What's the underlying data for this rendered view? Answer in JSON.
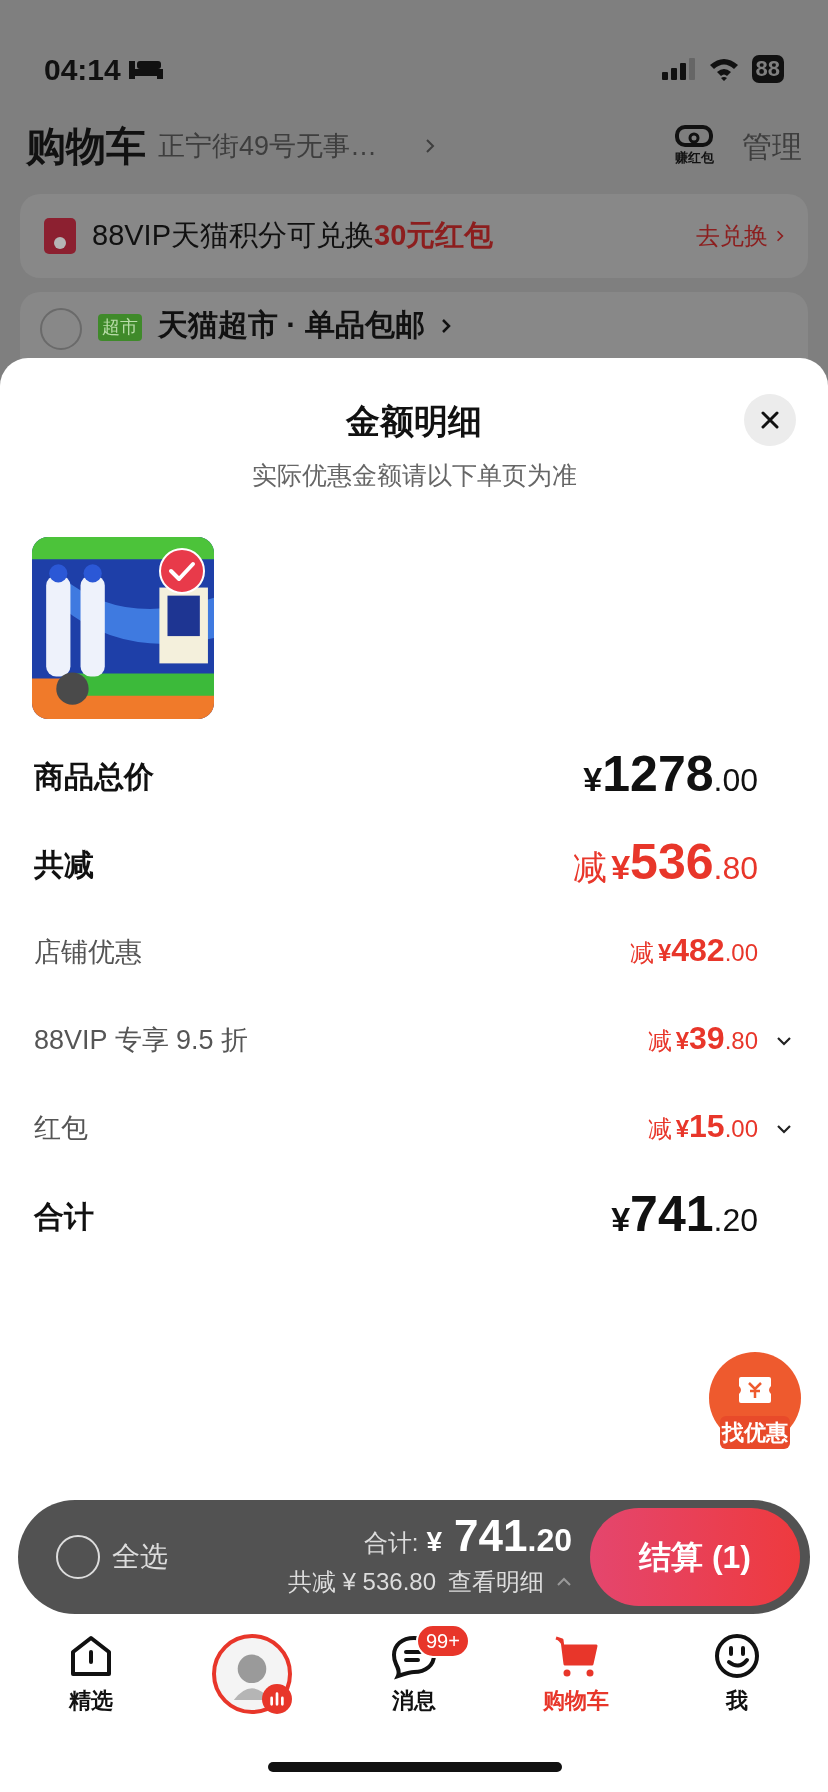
{
  "status_bar": {
    "time": "04:14",
    "battery": "88"
  },
  "header": {
    "title": "购物车",
    "address": "正宁街49号无事…",
    "earn_label": "赚红包",
    "manage": "管理"
  },
  "banner": {
    "text": "88VIP天猫积分可兑换",
    "highlight": "30元红包",
    "action": "去兑换"
  },
  "store": {
    "badge": "超市",
    "name": "天猫超市 · 单品包邮",
    "checked": false
  },
  "sheet": {
    "title": "金额明细",
    "subtitle": "实际优惠金额请以下单页为准",
    "product": {
      "kind": "picture",
      "selected": true
    },
    "rows": [
      {
        "kind": "major",
        "label": "商品总价",
        "prefix": "",
        "currency": "¥",
        "integer": "1278",
        "decimal": ".00",
        "expandable": false
      },
      {
        "kind": "major_discount",
        "label": "共减",
        "prefix": "减",
        "currency": "¥",
        "integer": "536",
        "decimal": ".80",
        "expandable": false
      },
      {
        "kind": "discount",
        "label": "店铺优惠",
        "prefix": "减",
        "currency": "¥",
        "integer": "482",
        "decimal": ".00",
        "expandable": false
      },
      {
        "kind": "discount",
        "label": "88VIP 专享 9.5 折",
        "prefix": "减",
        "currency": "¥",
        "integer": "39",
        "decimal": ".80",
        "expandable": true
      },
      {
        "kind": "discount",
        "label": "红包",
        "prefix": "减",
        "currency": "¥",
        "integer": "15",
        "decimal": ".00",
        "expandable": true
      },
      {
        "kind": "major",
        "label": "合计",
        "prefix": "",
        "currency": "¥",
        "integer": "741",
        "decimal": ".20",
        "expandable": false
      }
    ]
  },
  "floating_button": {
    "label": "找优惠"
  },
  "checkout": {
    "select_all": "全选",
    "checked": false,
    "total_label": "合计:",
    "currency": "¥",
    "total_integer": "741",
    "total_decimal": ".20",
    "saved": "共减 ¥ 536.80",
    "details": "查看明细",
    "button": "结算 (1)"
  },
  "tabs": [
    {
      "kind": "home",
      "label": "精选",
      "selected": false
    },
    {
      "kind": "avatar",
      "selected": false
    },
    {
      "kind": "message",
      "label": "消息",
      "badge": "99+",
      "selected": false
    },
    {
      "kind": "cart",
      "label": "购物车",
      "selected": true
    },
    {
      "kind": "me",
      "label": "我",
      "selected": false
    }
  ]
}
